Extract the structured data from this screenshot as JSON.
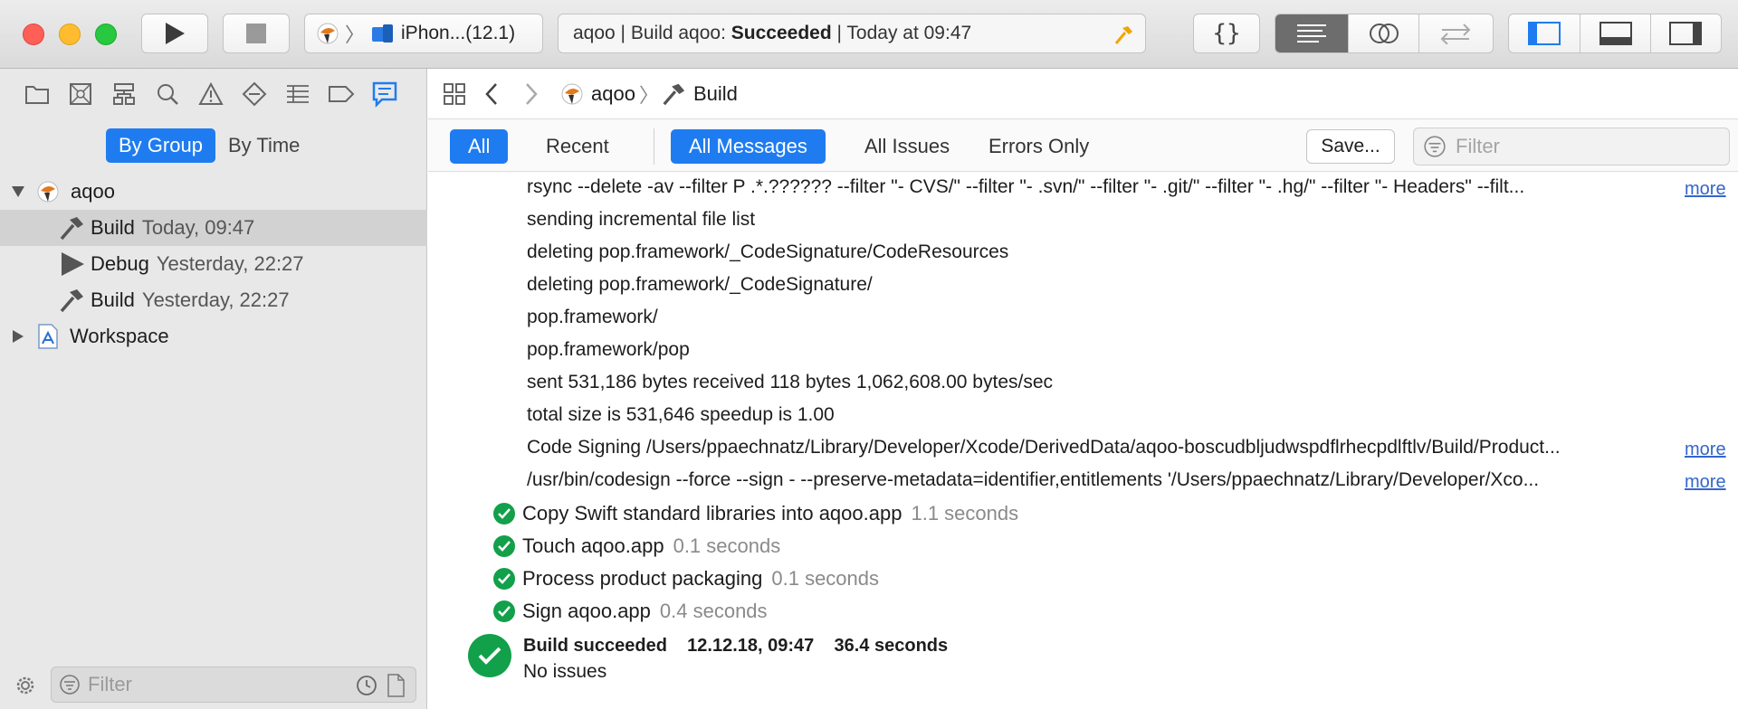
{
  "toolbar": {
    "scheme": {
      "project_label": "",
      "device": "iPhon...(12.1)"
    },
    "activity": {
      "prefix": "aqoo | Build aqoo: ",
      "status": "Succeeded",
      "suffix": " | Today at 09:47"
    }
  },
  "sidebar": {
    "group_toggle": {
      "by_group": "By Group",
      "by_time": "By Time"
    },
    "tree": {
      "project": "aqoo",
      "items": [
        {
          "label": "Build",
          "time": "Today, 09:47"
        },
        {
          "label": "Debug",
          "time": "Yesterday, 22:27"
        },
        {
          "label": "Build",
          "time": "Yesterday, 22:27"
        }
      ],
      "workspace": "Workspace"
    },
    "filter_placeholder": "Filter"
  },
  "main": {
    "jumpbar": {
      "project": "aqoo",
      "item": "Build"
    },
    "scope": {
      "all": "All",
      "recent": "Recent",
      "all_messages": "All Messages",
      "all_issues": "All Issues",
      "errors_only": "Errors Only",
      "save": "Save...",
      "filter_placeholder": "Filter"
    },
    "log_lines": [
      "rsync --delete -av --filter P .*.?????? --filter \"- CVS/\" --filter \"- .svn/\" --filter \"- .git/\" --filter \"- .hg/\" --filter \"- Headers\" --filt...",
      "sending incremental file list",
      "deleting pop.framework/_CodeSignature/CodeResources",
      "deleting pop.framework/_CodeSignature/",
      "pop.framework/",
      "pop.framework/pop",
      "sent 531,186 bytes  received 118 bytes  1,062,608.00 bytes/sec",
      "total size is 531,646  speedup is 1.00",
      "Code Signing /Users/ppaechnatz/Library/Developer/Xcode/DerivedData/aqoo-boscudbljudwspdflrhecpdlftlv/Build/Product...",
      "/usr/bin/codesign --force --sign -  --preserve-metadata=identifier,entitlements '/Users/ppaechnatz/Library/Developer/Xco..."
    ],
    "more_label": "more",
    "steps": [
      {
        "label": "Copy Swift standard libraries into aqoo.app",
        "duration": "1.1 seconds"
      },
      {
        "label": "Touch aqoo.app",
        "duration": "0.1 seconds"
      },
      {
        "label": "Process product packaging",
        "duration": "0.1 seconds"
      },
      {
        "label": "Sign aqoo.app",
        "duration": "0.4 seconds"
      }
    ],
    "result": {
      "title": "Build succeeded    12.12.18, 09:47    36.4 seconds",
      "subtitle": "No issues"
    }
  },
  "colors": {
    "accent": "#1f7cf0",
    "success": "#12a04a",
    "hammer": "#f0a500"
  }
}
